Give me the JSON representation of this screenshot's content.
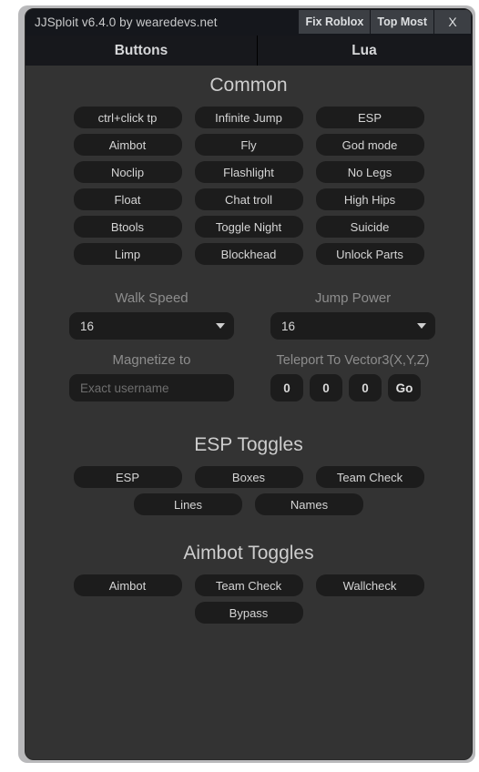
{
  "window": {
    "title": "JJSploit v6.4.0 by wearedevs.net",
    "titlebar_buttons": [
      {
        "label": "Fix Roblox",
        "name": "fix-roblox-button"
      },
      {
        "label": "Top Most",
        "name": "top-most-button"
      },
      {
        "label": "X",
        "name": "close-button"
      }
    ]
  },
  "tabs": [
    {
      "label": "Buttons",
      "active": true
    },
    {
      "label": "Lua",
      "active": false
    }
  ],
  "sections": {
    "common": {
      "title": "Common",
      "buttons": [
        "ctrl+click tp",
        "Infinite Jump",
        "ESP",
        "Aimbot",
        "Fly",
        "God mode",
        "Noclip",
        "Flashlight",
        "No Legs",
        "Float",
        "Chat troll",
        "High Hips",
        "Btools",
        "Toggle Night",
        "Suicide",
        "Limp",
        "Blockhead",
        "Unlock Parts"
      ]
    },
    "esp_toggles": {
      "title": "ESP Toggles",
      "buttons": [
        "ESP",
        "Boxes",
        "Team Check",
        "Lines",
        "Names"
      ]
    },
    "aimbot_toggles": {
      "title": "Aimbot Toggles",
      "buttons": [
        "Aimbot",
        "Team Check",
        "Wallcheck",
        "Bypass"
      ]
    }
  },
  "form": {
    "walk_speed": {
      "label": "Walk Speed",
      "value": "16"
    },
    "jump_power": {
      "label": "Jump Power",
      "value": "16"
    },
    "magnetize": {
      "label": "Magnetize to",
      "value": "",
      "placeholder": "Exact username"
    },
    "teleport": {
      "label": "Teleport To Vector3(X,Y,Z)",
      "x": "0",
      "y": "0",
      "z": "0",
      "go_label": "Go"
    }
  },
  "colors": {
    "window_bg": "#333333",
    "titlebar_bg": "#15171c",
    "tabbar_bg": "#17181c",
    "button_bg": "#1c1c1c",
    "text": "#d5d5d5",
    "muted_text": "#8d8d8d"
  }
}
